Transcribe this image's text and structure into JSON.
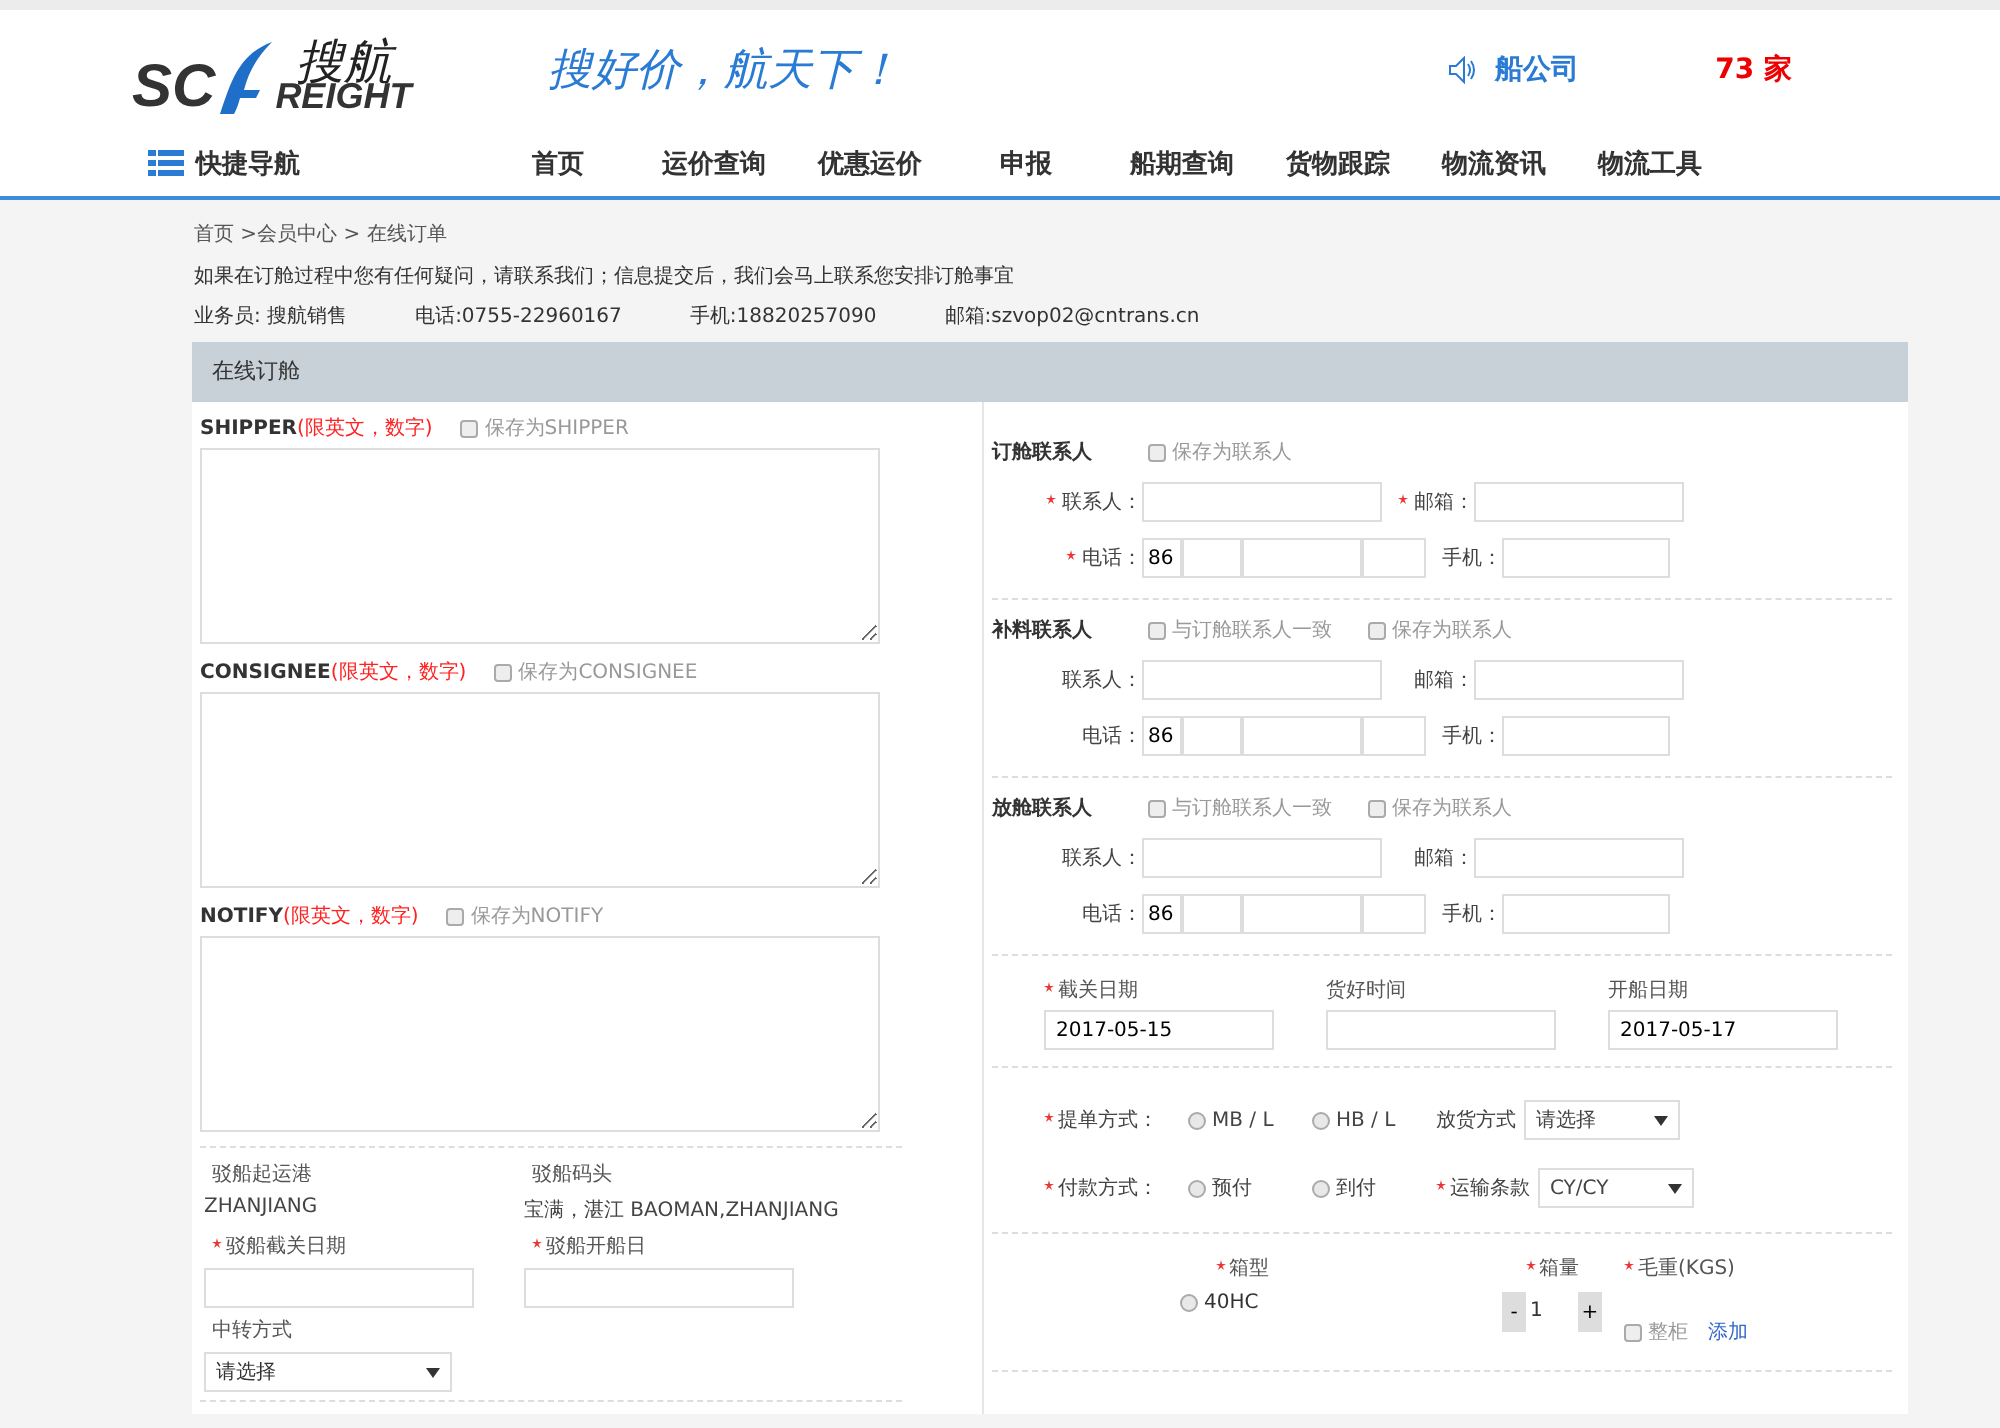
{
  "header": {
    "logo": {
      "latin_left": "SC",
      "latin_right": "REIGHT",
      "chinese": "搜航"
    },
    "slogan": "搜好价，航天下！",
    "ticker": {
      "label": "船公司",
      "count": "73 家"
    }
  },
  "nav": {
    "quick": "快捷导航",
    "items": [
      "首页",
      "运价查询",
      "优惠运价",
      "申报",
      "船期查询",
      "货物跟踪",
      "物流资讯",
      "物流工具"
    ]
  },
  "breadcrumb": "首页 >会员中心 > 在线订单",
  "notice": "如果在订舱过程中您有任何疑问，请联系我们；信息提交后，我们会马上联系您安排订舱事宜",
  "contacts": [
    "业务员: 搜航销售",
    "电话:0755-22960167",
    "手机:18820257090",
    "邮箱:szvop02@cntrans.cn"
  ],
  "panel_title": "在线订舱",
  "parties": [
    {
      "name": "SHIPPER",
      "hint": "(限英文，数字)",
      "save": {
        "label": "保存为SHIPPER",
        "checked": false
      }
    },
    {
      "name": "CONSIGNEE",
      "hint": "(限英文，数字)",
      "save": {
        "label": "保存为CONSIGNEE",
        "checked": false
      }
    },
    {
      "name": "NOTIFY",
      "hint": "(限英文，数字)",
      "save": {
        "label": "保存为NOTIFY",
        "checked": false
      }
    }
  ],
  "feeder": {
    "fields": [
      {
        "label": "驳船起运港",
        "value": "ZHANJIANG"
      },
      {
        "label": "驳船码头",
        "value": "宝满，湛江 BAOMAN,ZHANJIANG"
      }
    ],
    "dates": [
      {
        "label": "驳船截关日期",
        "required": true
      },
      {
        "label": "驳船开船日",
        "required": true
      }
    ],
    "transfer": {
      "label": "中转方式",
      "value": "请选择"
    }
  },
  "contact_groups": [
    {
      "title": "订舱联系人",
      "required": true,
      "options": [
        {
          "label": "保存为联系人",
          "checked": false
        }
      ],
      "name_label": "联系人：",
      "email_label": "邮箱：",
      "phone_label": "电话：",
      "phone_code": "86",
      "mobile_label": "手机："
    },
    {
      "title": "补料联系人",
      "required": false,
      "options": [
        {
          "label": "与订舱联系人一致",
          "checked": false
        },
        {
          "label": "保存为联系人",
          "checked": false
        }
      ],
      "name_label": "联系人：",
      "email_label": "邮箱：",
      "phone_label": "电话：",
      "phone_code": "86",
      "mobile_label": "手机："
    },
    {
      "title": "放舱联系人",
      "required": false,
      "options": [
        {
          "label": "与订舱联系人一致",
          "checked": false
        },
        {
          "label": "保存为联系人",
          "checked": false
        }
      ],
      "name_label": "联系人：",
      "email_label": "邮箱：",
      "phone_label": "电话：",
      "phone_code": "86",
      "mobile_label": "手机："
    }
  ],
  "dates": [
    {
      "label": "截关日期",
      "required": true,
      "value": "2017-05-15"
    },
    {
      "label": "货好时间",
      "required": false
    },
    {
      "label": "开船日期",
      "required": false,
      "value": "2017-05-17"
    }
  ],
  "choice_rows": [
    {
      "label": "提单方式：",
      "required": true,
      "options": [
        {
          "label": "MB / L",
          "selected": false
        },
        {
          "label": "HB / L",
          "selected": false
        }
      ],
      "select": {
        "label": "放货方式",
        "required": false,
        "value": "请选择"
      }
    },
    {
      "label": "付款方式：",
      "required": true,
      "options": [
        {
          "label": "预付",
          "selected": false
        },
        {
          "label": "到付",
          "selected": false
        }
      ],
      "select": {
        "label": "运输条款",
        "required": true,
        "value": "CY/CY"
      }
    }
  ],
  "container": {
    "type_label": "箱型",
    "type_required": true,
    "types": [
      {
        "label": "40HC",
        "selected": false
      }
    ],
    "qty_label": "箱量",
    "qty_required": true,
    "qty": "1",
    "minus": "-",
    "plus": "+",
    "weight_label": "毛重(KGS)",
    "weight_required": true,
    "soc": {
      "label": "整柜",
      "checked": false
    },
    "add": "添加"
  }
}
